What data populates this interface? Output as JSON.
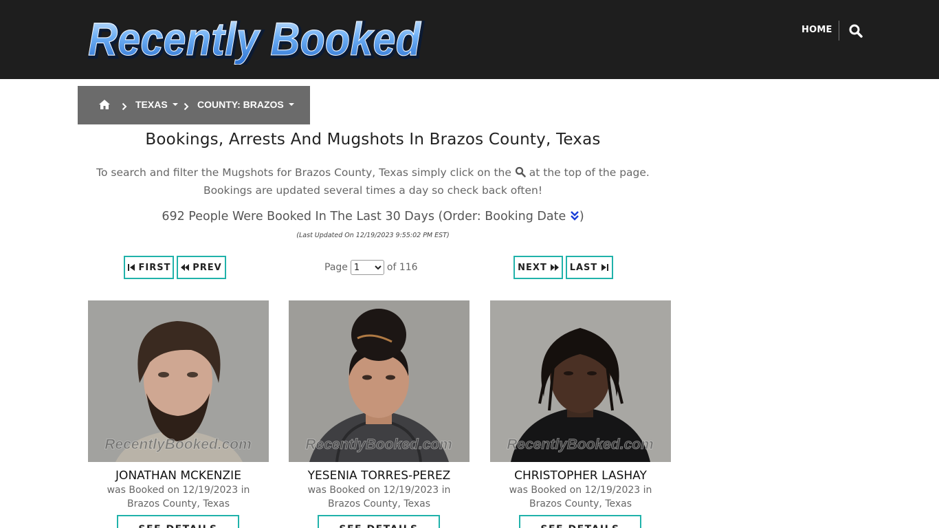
{
  "header": {
    "logo_text": "Recently Booked",
    "nav_home": "HOME",
    "search_icon": "search-icon"
  },
  "breadcrumb": {
    "home_icon": "home-icon",
    "state": "TEXAS",
    "county": "COUNTY: BRAZOS"
  },
  "main": {
    "title": "Bookings, Arrests And Mugshots In Brazos County, Texas",
    "intro_before": "To search and filter the Mugshots for Brazos County, Texas simply click on the",
    "intro_after": "at the top of the page. Bookings are updated several times a day so check back often!",
    "count_text": "692 People Were Booked In The Last 30 Days (Order: Booking Date",
    "count_close": ")",
    "last_updated": "(Last Updated On 12/19/2023 9:55:02 PM EST)"
  },
  "pagination": {
    "first": "FIRST",
    "prev": "PREV",
    "next": "NEXT",
    "last": "LAST",
    "page_label": "Page",
    "page_value": "1",
    "of_label": "of 116"
  },
  "cards": [
    {
      "name": "JONATHAN MCKENZIE",
      "desc_line1": "was Booked on 12/19/2023 in",
      "desc_line2": "Brazos County, Texas",
      "watermark": "RecentlyBooked.com",
      "button": "SEE DETAILS"
    },
    {
      "name": "YESENIA TORRES-PEREZ",
      "desc_line1": "was Booked on 12/19/2023 in",
      "desc_line2": "Brazos County, Texas",
      "watermark": "RecentlyBooked.com",
      "button": "SEE DETAILS"
    },
    {
      "name": "CHRISTOPHER LASHAY",
      "desc_line1": "was Booked on 12/19/2023 in",
      "desc_line2": "Brazos County, Texas",
      "watermark": "RecentlyBooked.com",
      "button": "SEE DETAILS"
    }
  ],
  "colors": {
    "header_bg": "#1e1e1e",
    "breadcrumb_bg": "#6b6b6b",
    "accent": "#20b2aa",
    "logo_blue": "#5aa0f0"
  }
}
